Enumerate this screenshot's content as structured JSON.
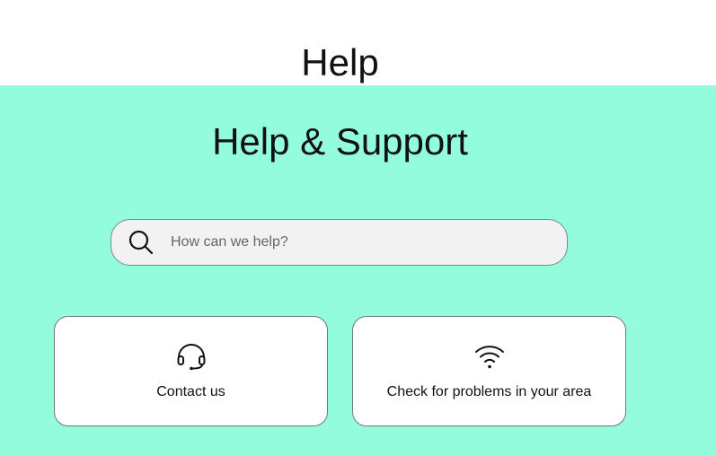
{
  "header": {
    "title": "Help"
  },
  "hero": {
    "title": "Help & Support",
    "background_color": "#92fcdc"
  },
  "search": {
    "placeholder": "How can we help?",
    "value": "",
    "icon": "search-icon"
  },
  "cards": [
    {
      "label": "Contact us",
      "icon": "headset-icon"
    },
    {
      "label": "Check for problems in your area",
      "icon": "wifi-icon"
    }
  ]
}
